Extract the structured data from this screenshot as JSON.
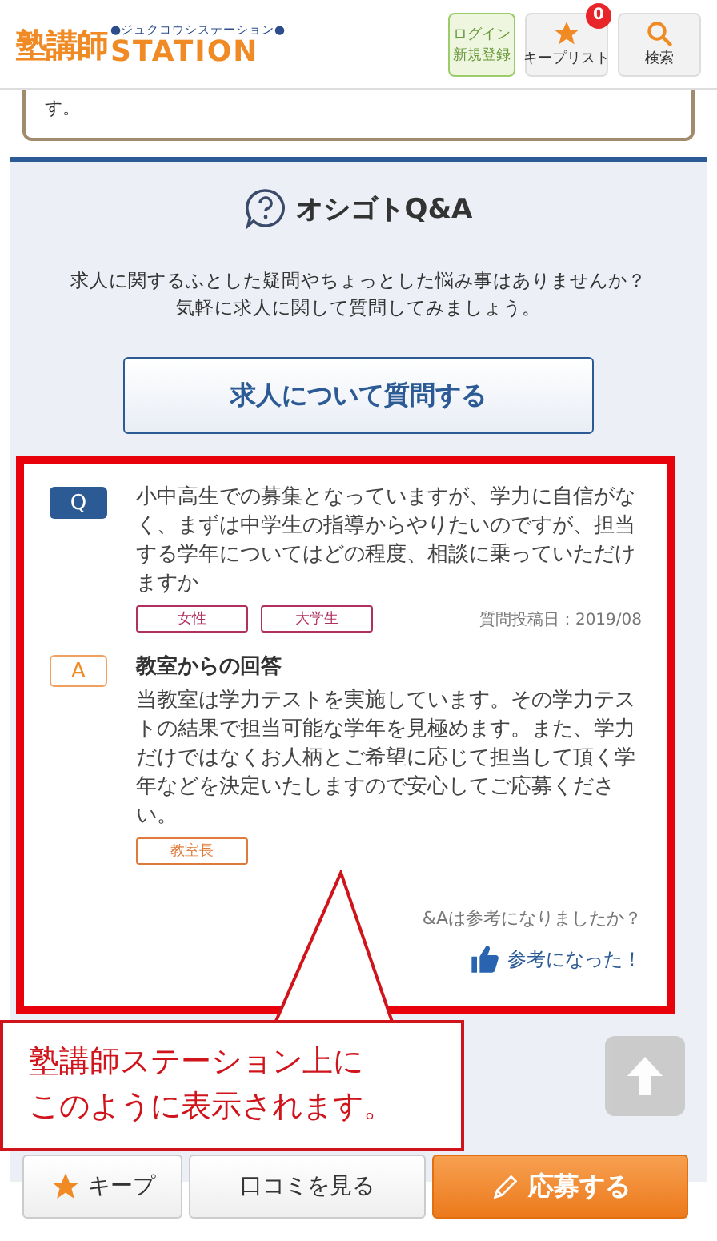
{
  "header": {
    "logo": "塾講師",
    "logo_sub": "STATION",
    "logo_ruby": "●ジュクコウシステーション●",
    "login": [
      "ログイン",
      "新規登録"
    ],
    "keep_list": {
      "label": "キープリスト",
      "count": "0"
    },
    "search": "検索"
  },
  "prev_card": {
    "text": "す。"
  },
  "qa_section": {
    "title": "オシゴトQ&A",
    "description": [
      "求人に関するふとした疑問やちょっとした悩み事はありませんか？",
      "気軽に求人に関して質問してみましょう。"
    ],
    "ask_button": "求人について質問する",
    "question": {
      "badge": "Q",
      "text": "小中高生での募集となっていますが、学力に自信がなく、まずは中学生の指導からやりたいのですが、担当する学年についてはどの程度、相談に乗っていただけますか",
      "tags": [
        "女性",
        "大学生"
      ],
      "date": "質問投稿日：2019/08"
    },
    "answer": {
      "badge": "A",
      "title": "教室からの回答",
      "text": "当教室は学力テストを実施しています。その学力テストの結果で担当可能な学年を見極めます。また、学力だけではなくお人柄とご希望に応じて担当して頂く学年などを決定いたしますので安心してご応募ください。",
      "tags": [
        "教室長"
      ]
    },
    "helpful_question": "&Aは参考になりましたか？",
    "helpful_button": "参考になった！"
  },
  "callout": [
    "塾講師ステーション上に",
    "このように表示されます。"
  ],
  "bottom_bar": {
    "keep": "キープ",
    "reviews": "口コミを見る",
    "apply": "応募する"
  }
}
